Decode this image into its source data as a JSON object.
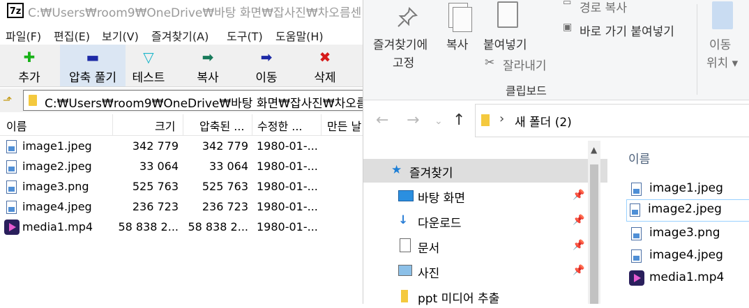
{
  "zip": {
    "title": "C:₩Users₩room9₩OneDrive₩바탕 화면₩잡사진₩차오름센",
    "app_icon": "7z",
    "menu": [
      "파일(F)",
      "편집(E)",
      "보기(V)",
      "즐겨찾기(A)",
      "도구(T)",
      "도움말(H)"
    ],
    "toolbar": [
      {
        "label": "추가",
        "icon": "plus-icon",
        "glyph": "✚",
        "color": "#19b219"
      },
      {
        "label": "압축 풀기",
        "icon": "minus-icon",
        "glyph": "▬",
        "color": "#1d2aa6"
      },
      {
        "label": "테스트",
        "icon": "check-icon",
        "glyph": "▽",
        "color": "#1ab5c9"
      },
      {
        "label": "복사",
        "icon": "copy-arrow-icon",
        "glyph": "➡",
        "color": "#177a5a"
      },
      {
        "label": "이동",
        "icon": "move-arrow-icon",
        "glyph": "➡",
        "color": "#1d2aa6"
      },
      {
        "label": "삭제",
        "icon": "delete-x-icon",
        "glyph": "✖",
        "color": "#d61a1a"
      }
    ],
    "address": "C:₩Users₩room9₩OneDrive₩바탕 화면₩잡사진₩차오름",
    "columns": [
      "이름",
      "크기",
      "압축된 ...",
      "수정한 ...",
      "만든 날"
    ],
    "files": [
      {
        "name": "image1.jpeg",
        "size": "342 779",
        "packed": "342 779",
        "modified": "1980-01-...",
        "type": "image"
      },
      {
        "name": "image2.jpeg",
        "size": "33 064",
        "packed": "33 064",
        "modified": "1980-01-...",
        "type": "image"
      },
      {
        "name": "image3.png",
        "size": "525 763",
        "packed": "525 763",
        "modified": "1980-01-...",
        "type": "image"
      },
      {
        "name": "image4.jpeg",
        "size": "236 723",
        "packed": "236 723",
        "modified": "1980-01-...",
        "type": "image"
      },
      {
        "name": "media1.mp4",
        "size": "58 838 2...",
        "packed": "58 838 2...",
        "modified": "1980-01-...",
        "type": "video"
      }
    ]
  },
  "explorer": {
    "ribbon": {
      "pin_quick": [
        "즐겨찾기에",
        "고정"
      ],
      "copy": "복사",
      "paste": "붙여넣기",
      "cut": "잘라내기",
      "copy_path": "경로 복사",
      "paste_shortcut": "바로 가기 붙여넣기",
      "group_clipboard": "클립보드",
      "move_to": [
        "이동",
        "위치 ▾"
      ]
    },
    "breadcrumb": "새 폴더 (2)",
    "nav_items": [
      {
        "label": "즐겨찾기",
        "icon": "star-icon",
        "selected": true,
        "pinned": false
      },
      {
        "label": "바탕 화면",
        "icon": "desktop-icon",
        "selected": false,
        "pinned": true
      },
      {
        "label": "다운로드",
        "icon": "download-icon",
        "selected": false,
        "pinned": true
      },
      {
        "label": "문서",
        "icon": "document-icon",
        "selected": false,
        "pinned": true
      },
      {
        "label": "사진",
        "icon": "pictures-icon",
        "selected": false,
        "pinned": true
      },
      {
        "label": "ppt 미디어 추출",
        "icon": "folder-icon",
        "selected": false,
        "pinned": false
      }
    ],
    "content_header": "이름",
    "content_files": [
      {
        "name": "image1.jpeg",
        "type": "image"
      },
      {
        "name": "image2.jpeg",
        "type": "image",
        "selected": true
      },
      {
        "name": "image3.png",
        "type": "image"
      },
      {
        "name": "image4.jpeg",
        "type": "image"
      },
      {
        "name": "media1.mp4",
        "type": "video"
      }
    ]
  }
}
